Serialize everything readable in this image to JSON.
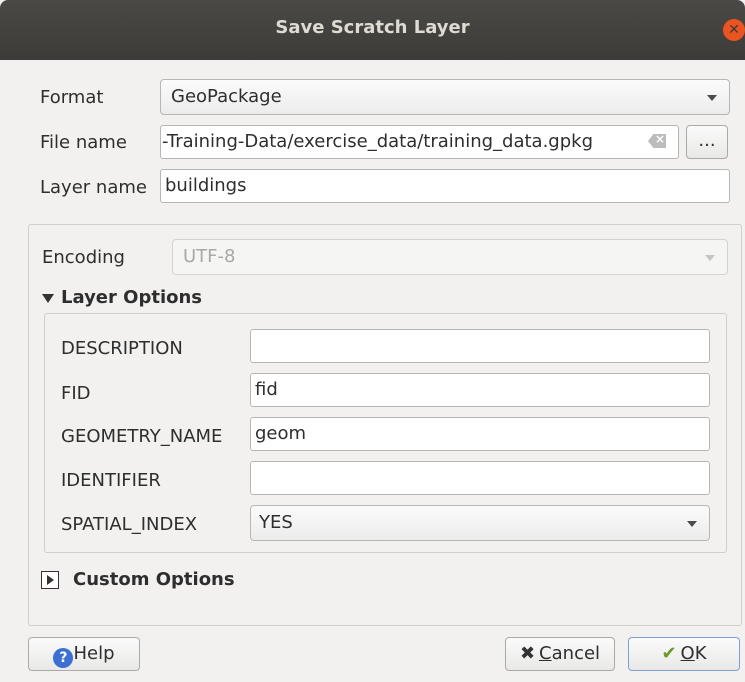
{
  "dialog": {
    "title": "Save Scratch Layer",
    "close_icon": "close-icon"
  },
  "form": {
    "format": {
      "label": "Format",
      "value": "GeoPackage"
    },
    "file_name": {
      "label": "File name",
      "value": "-Training-Data/exercise_data/training_data.gpkg",
      "browse_label": "..."
    },
    "layer_name": {
      "label": "Layer name",
      "value": "buildings"
    },
    "encoding": {
      "label": "Encoding",
      "value": "UTF-8",
      "enabled": false
    }
  },
  "layer_options": {
    "header": "Layer Options",
    "expanded": true,
    "fields": [
      {
        "label": "DESCRIPTION",
        "value": ""
      },
      {
        "label": "FID",
        "value": "fid"
      },
      {
        "label": "GEOMETRY_NAME",
        "value": "geom"
      },
      {
        "label": "IDENTIFIER",
        "value": ""
      },
      {
        "label": "SPATIAL_INDEX",
        "value": "YES"
      }
    ]
  },
  "custom_options": {
    "header": "Custom Options",
    "expanded": false
  },
  "buttons": {
    "help": "Help",
    "cancel_prefix": "",
    "cancel_underlined": "C",
    "cancel_rest": "ancel",
    "ok_underlined": "O",
    "ok_rest": "K"
  },
  "colors": {
    "titlebar": "#3c3b37",
    "close_button": "#e95420",
    "dialog_bg": "#f2f1f0",
    "help_icon": "#3b6fd1",
    "ok_check": "#6a9a2b"
  }
}
